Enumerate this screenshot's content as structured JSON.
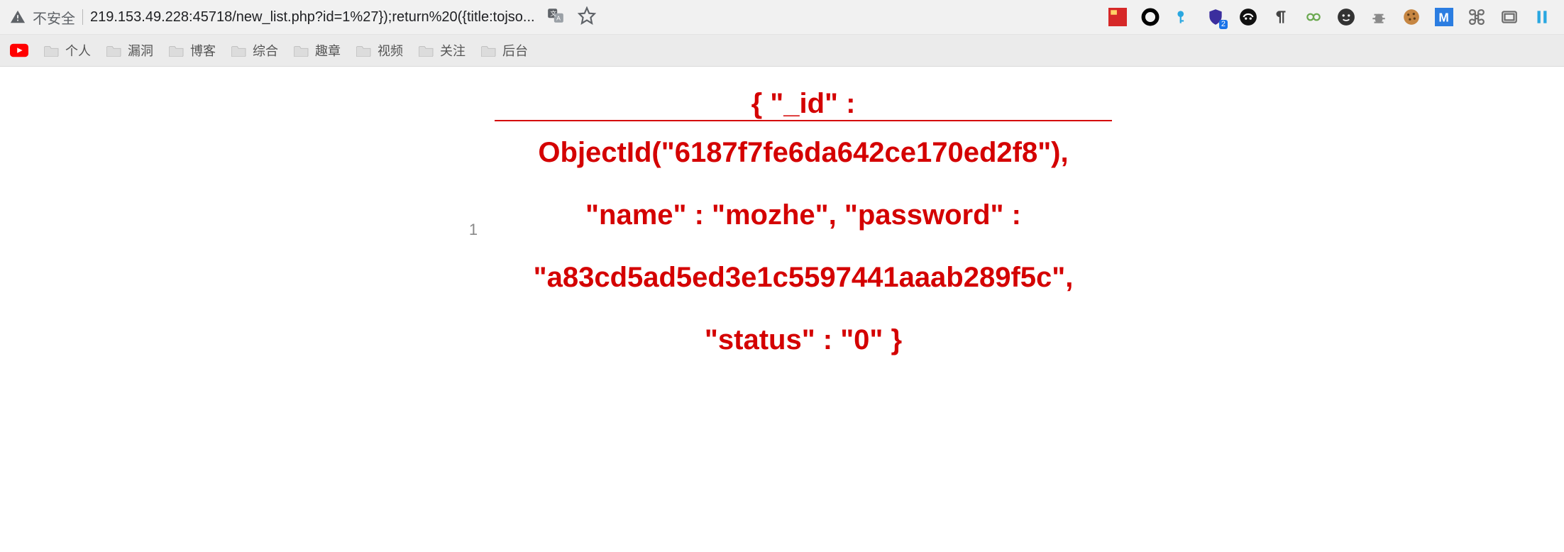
{
  "omnibox": {
    "insecure_label": "不安全",
    "url_display": "219.153.49.228:45718/new_list.php?id=1%27});return%20({title:tojso..."
  },
  "bookmarks": [
    {
      "label": "个人",
      "type": "folder"
    },
    {
      "label": "漏洞",
      "type": "folder"
    },
    {
      "label": "博客",
      "type": "folder"
    },
    {
      "label": "综合",
      "type": "folder"
    },
    {
      "label": "趣章",
      "type": "folder"
    },
    {
      "label": "视频",
      "type": "folder"
    },
    {
      "label": "关注",
      "type": "folder"
    },
    {
      "label": "后台",
      "type": "folder"
    }
  ],
  "extension_badge": "2",
  "content": {
    "row_number": "1",
    "header_text": "{ \"_id\" :",
    "body_text": "ObjectId(\"6187f7fe6da642ce170ed2f8\"), \"name\" : \"mozhe\", \"password\" : \"a83cd5ad5ed3e1c5597441aaab289f5c\", \"status\" : \"0\" }"
  }
}
